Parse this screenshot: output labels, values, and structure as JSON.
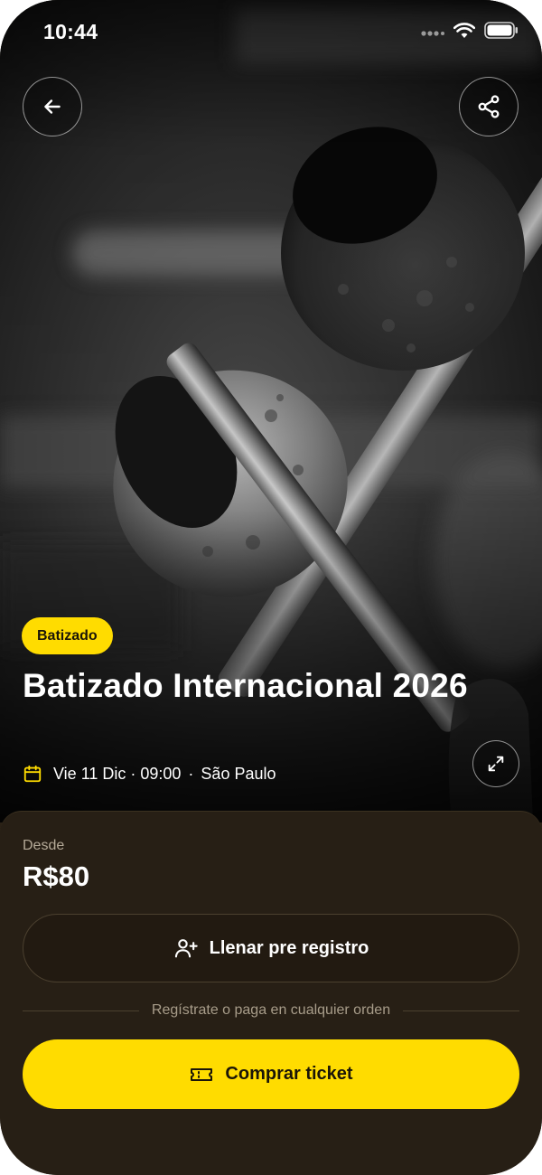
{
  "status_bar": {
    "time": "10:44"
  },
  "event": {
    "category": "Batizado",
    "title": "Batizado Internacional 2026",
    "date_time": "Vie 11 Dic · 09:00",
    "separator": "·",
    "location": "São Paulo"
  },
  "pricing": {
    "from_label": "Desde",
    "price": "R$80"
  },
  "actions": {
    "preregister_label": "Llenar pre registro",
    "hint": "Regístrate o paga en cualquier orden",
    "buy_label": "Comprar ticket"
  },
  "icons": {
    "back": "arrow-left-icon",
    "share": "share-icon",
    "expand": "expand-icon",
    "calendar": "calendar-icon",
    "add_user": "user-plus-icon",
    "ticket": "ticket-icon",
    "signal": "signal-dots-icon",
    "wifi": "wifi-icon",
    "battery": "battery-icon"
  },
  "colors": {
    "accent": "#ffdc00",
    "sheet_background": "#271f15",
    "muted_text": "#b5aa98"
  }
}
